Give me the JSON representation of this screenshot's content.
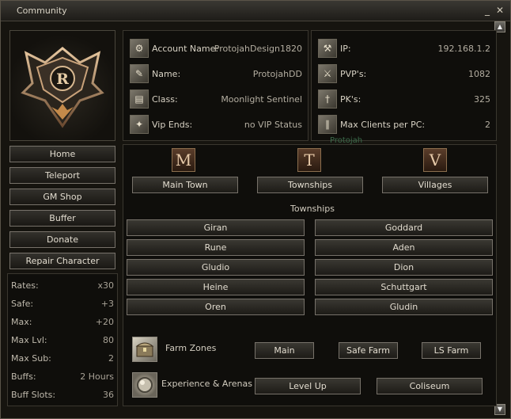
{
  "window": {
    "title": "Community"
  },
  "account": {
    "name_label": "Account Name:",
    "name_value": "ProtojahDesign1820",
    "char_label": "Name:",
    "char_value": "ProtojahDD",
    "class_label": "Class:",
    "class_value": "Moonlight Sentinel",
    "vip_label": "Vip Ends:",
    "vip_value": "no VIP Status",
    "ip_label": "IP:",
    "ip_value": "192.168.1.2",
    "pvp_label": "PVP's:",
    "pvp_value": "1082",
    "pk_label": "PK's:",
    "pk_value": "325",
    "maxclients_label": "Max Clients per PC:",
    "maxclients_value": "2",
    "ghost_text": "Protojah"
  },
  "menu": [
    "Home",
    "Teleport",
    "GM Shop",
    "Buffer",
    "Donate",
    "Repair Character"
  ],
  "stats": [
    {
      "k": "Rates:",
      "v": "x30"
    },
    {
      "k": "Safe:",
      "v": "+3"
    },
    {
      "k": "Max:",
      "v": "+20"
    },
    {
      "k": "Max Lvl:",
      "v": "80"
    },
    {
      "k": "Max Sub:",
      "v": "2"
    },
    {
      "k": "Buffs:",
      "v": "2 Hours"
    },
    {
      "k": "Buff Slots:",
      "v": "36"
    }
  ],
  "categories": {
    "main_town": {
      "letter": "M",
      "label": "Main Town"
    },
    "townships": {
      "letter": "T",
      "label": "Townships"
    },
    "villages": {
      "letter": "V",
      "label": "Villages"
    }
  },
  "townships_title": "Townships",
  "towns_left": [
    "Giran",
    "Rune",
    "Gludio",
    "Heine",
    "Oren"
  ],
  "towns_right": [
    "Goddard",
    "Aden",
    "Dion",
    "Schuttgart",
    "Gludin"
  ],
  "farm": {
    "label": "Farm Zones",
    "main": "Main",
    "safe": "Safe Farm",
    "ls": "LS Farm"
  },
  "exp": {
    "label": "Experience & Arenas",
    "levelup": "Level Up",
    "coliseum": "Coliseum"
  }
}
